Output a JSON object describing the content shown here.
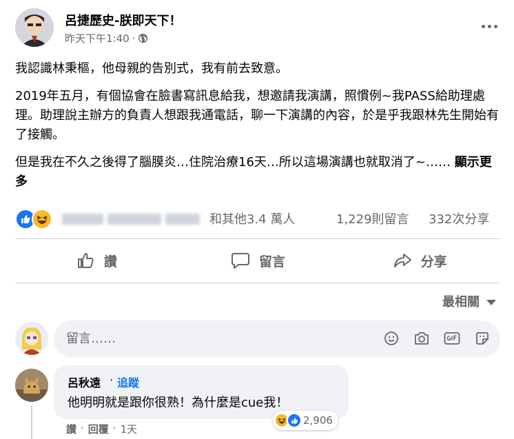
{
  "post": {
    "page_name": "呂捷歷史-朕即天下！",
    "timestamp": "昨天下午1:40",
    "dot": "·",
    "paragraphs": [
      "我認識林秉樞，他母親的告別式，我有前去致意。",
      "2019年五月，有個協會在臉書寫訊息給我，想邀請我演講，照慣例~我PASS給助理處理。助理說主辦方的負責人想跟我通電話，聊一下演講的內容，於是乎我跟林先生開始有了接觸。",
      "但是我在不久之後得了腦膜炎…住院治療16天…所以這場演講也就取消了~……"
    ],
    "see_more": "顯示更多"
  },
  "stats": {
    "reactions_summary": "和其他3.4 萬人",
    "comments": "1,229則留言",
    "shares": "332次分享"
  },
  "actions": {
    "like": "讚",
    "comment": "留言",
    "share": "分享"
  },
  "sort": {
    "label": "最相關"
  },
  "composer": {
    "placeholder": "留言……"
  },
  "comment": {
    "author": "呂秋遠",
    "dot": "·",
    "follow": "追蹤",
    "text": "他明明就是跟你很熟！為什麼是cue我！",
    "reaction_count": "2,906",
    "like": "讚",
    "reply": "回覆",
    "age": "1天",
    "sep": "·"
  },
  "colors": {
    "accent": "#1877f2",
    "secondary_text": "#65676b",
    "bubble": "#f0f2f5",
    "haha": "#f7b928"
  }
}
